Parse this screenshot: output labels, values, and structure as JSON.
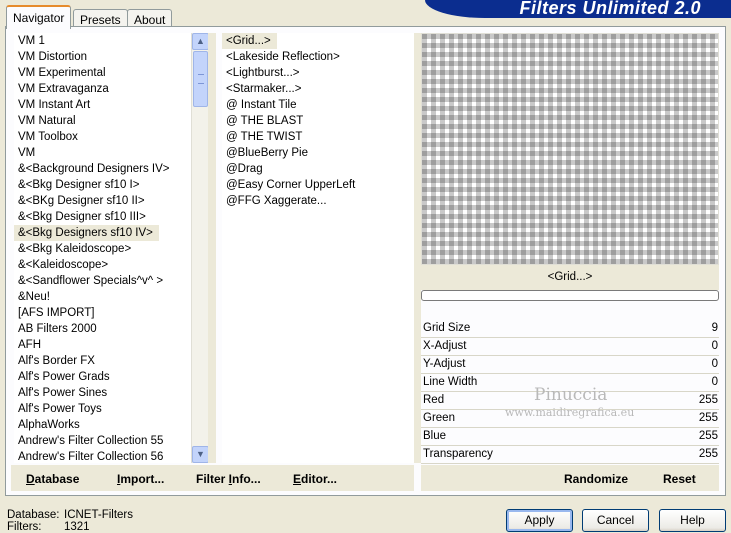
{
  "tabs": [
    {
      "label": "Navigator",
      "active": true
    },
    {
      "label": "Presets",
      "active": false
    },
    {
      "label": "About",
      "active": false
    }
  ],
  "banner_title": "Filters Unlimited 2.0",
  "categories": [
    "VM 1",
    "VM Distortion",
    "VM Experimental",
    "VM Extravaganza",
    "VM Instant Art",
    "VM Natural",
    "VM Toolbox",
    "VM",
    "&<Background Designers IV>",
    "&<Bkg Designer sf10 I>",
    "&<BKg Designer sf10 II>",
    "&<Bkg Designer sf10 III>",
    "&<Bkg Designers sf10 IV>",
    "&<Bkg Kaleidoscope>",
    "&<Kaleidoscope>",
    "&<Sandflower Specials^v^ >",
    "&Neu!",
    "[AFS IMPORT]",
    "AB Filters 2000",
    "AFH",
    "Alf's Border FX",
    "Alf's Power Grads",
    "Alf's Power Sines",
    "Alf's Power Toys",
    "AlphaWorks",
    "Andrew's Filter Collection 55",
    "Andrew's Filter Collection 56"
  ],
  "selected_category": "&<Bkg Designers sf10 IV>",
  "filters": [
    "<Grid...>",
    "<Lakeside Reflection>",
    "<Lightburst...>",
    "<Starmaker...>",
    "@ Instant Tile",
    "@ THE BLAST",
    "@ THE TWIST",
    "@BlueBerry Pie",
    "@Drag",
    "@Easy Corner UpperLeft",
    "@FFG Xaggerate..."
  ],
  "selected_filter": "<Grid...>",
  "preview_label": "<Grid...>",
  "parameters": [
    {
      "label": "Grid Size",
      "value": "9"
    },
    {
      "label": "X-Adjust",
      "value": "0"
    },
    {
      "label": "Y-Adjust",
      "value": "0"
    },
    {
      "label": "Line Width",
      "value": "0"
    },
    {
      "label": "Red",
      "value": "255"
    },
    {
      "label": "Green",
      "value": "255"
    },
    {
      "label": "Blue",
      "value": "255"
    },
    {
      "label": "Transparency",
      "value": "255"
    }
  ],
  "watermark": {
    "name": "Pinuccia",
    "url": "www.maidiregrafica.eu"
  },
  "actions": {
    "database": {
      "underline": "D",
      "rest": "atabase"
    },
    "import": {
      "underline": "I",
      "rest": "mport..."
    },
    "filter_info": {
      "pre": "Filter ",
      "underline": "I",
      "rest": "nfo..."
    },
    "editor": {
      "underline": "E",
      "rest": "ditor..."
    },
    "randomize": "Randomize",
    "reset": "Reset"
  },
  "status": {
    "database_label": "Database:",
    "database_value": "ICNET-Filters",
    "filters_label": "Filters:",
    "filters_value": "1321"
  },
  "buttons": {
    "apply": "Apply",
    "cancel": "Cancel",
    "help": "Help"
  },
  "colors": {
    "banner": "#0b2d8f",
    "tab_accent": "#e68b2c",
    "panel_bg": "#ece9d8"
  }
}
